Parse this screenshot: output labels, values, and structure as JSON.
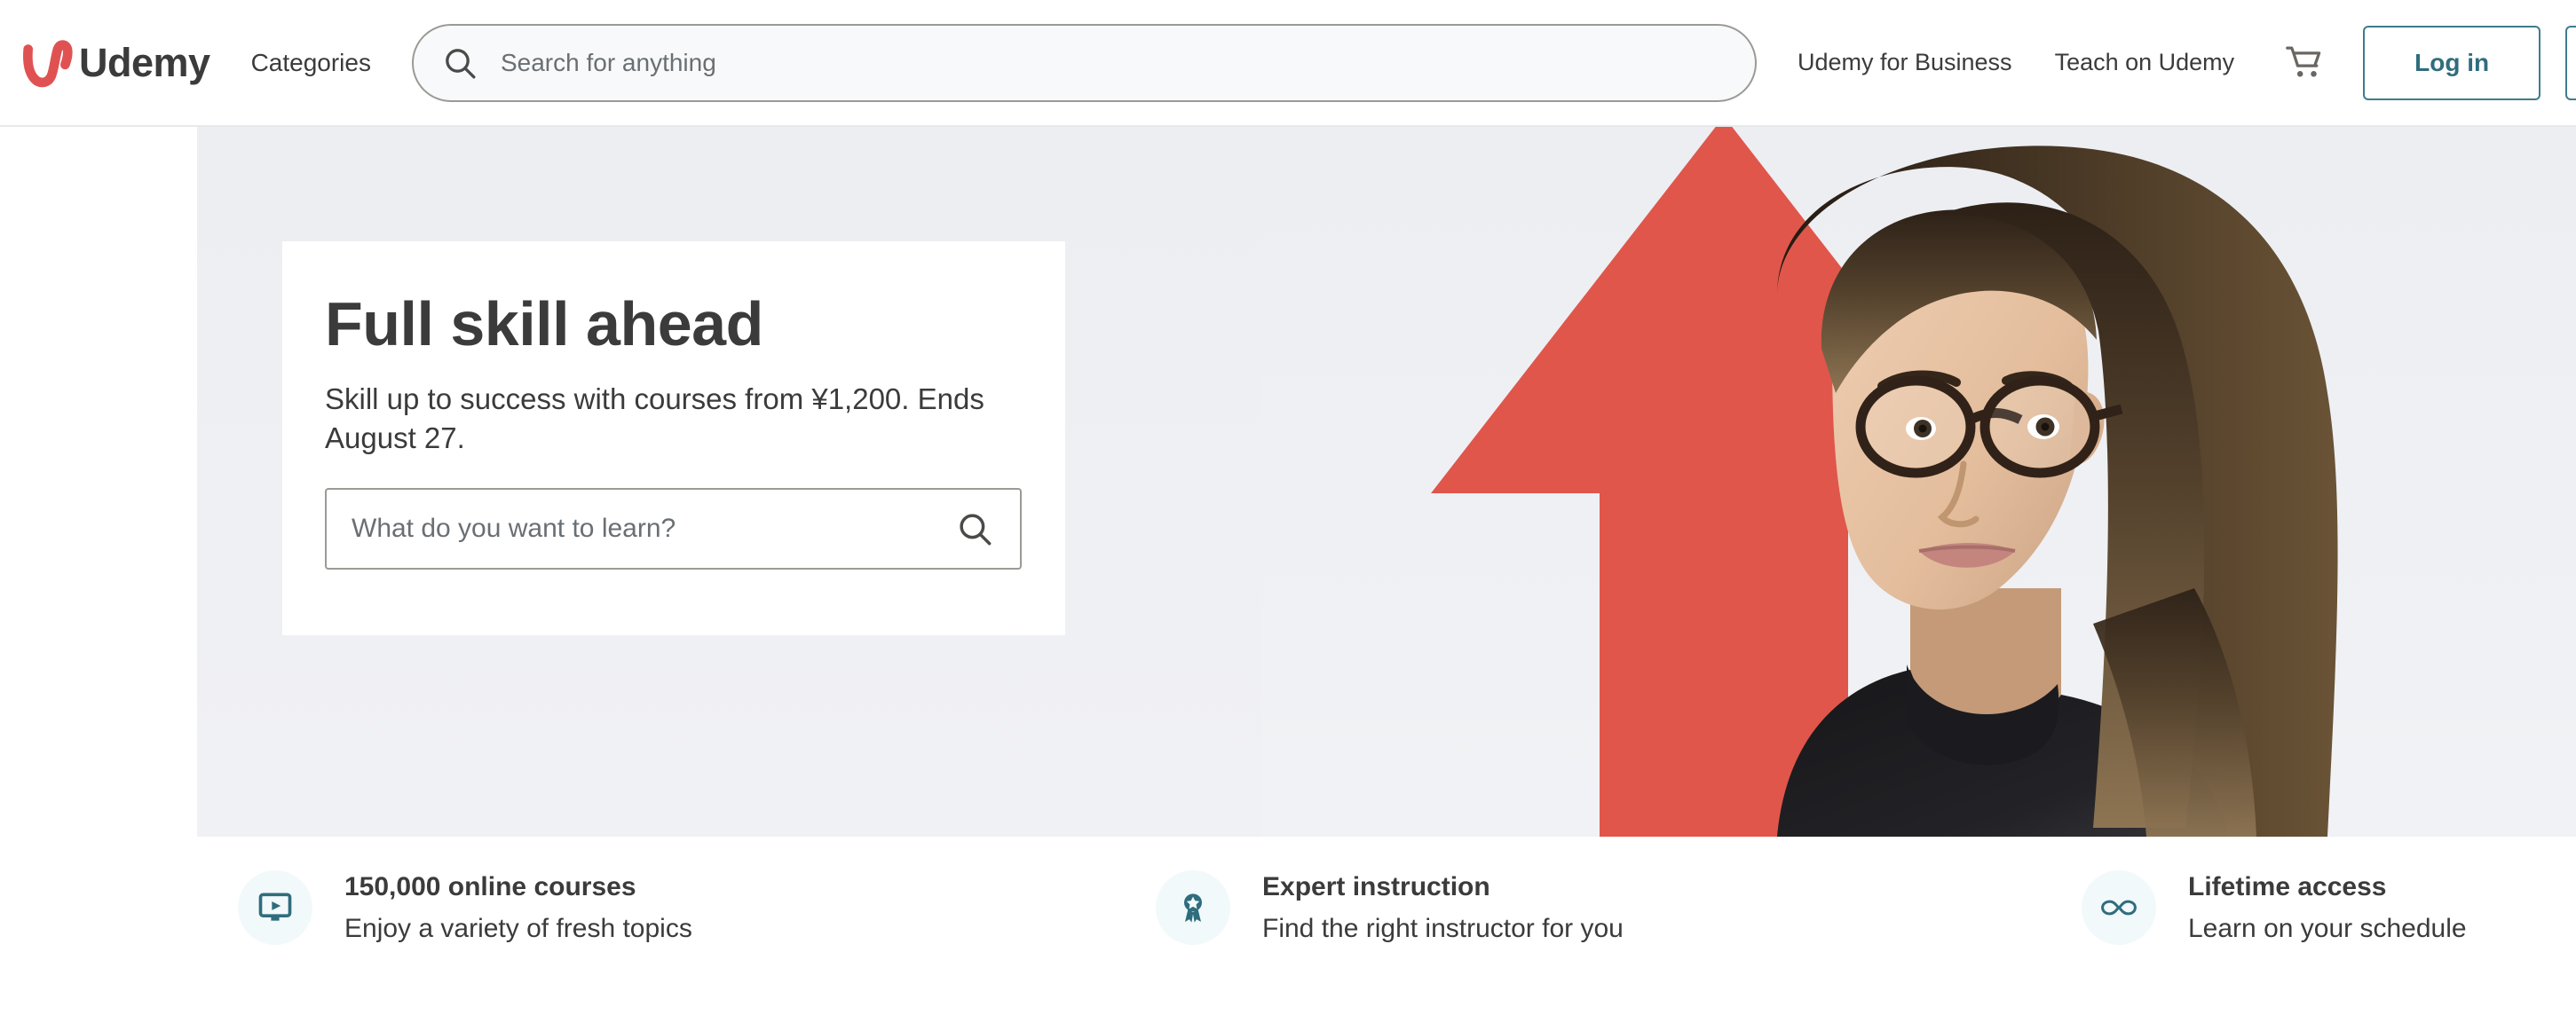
{
  "brand": {
    "name": "Udemy",
    "logo_color": "#e05252",
    "wordmark_color": "#3b3b3b",
    "accent_color": "#2f6d7d"
  },
  "header": {
    "categories_label": "Categories",
    "search": {
      "placeholder": "Search for anything",
      "value": "",
      "icon": "search-icon"
    },
    "links": [
      {
        "label": "Udemy for Business"
      },
      {
        "label": "Teach on Udemy"
      }
    ],
    "cart_icon": "shopping-cart-icon",
    "login_label": "Log in",
    "signup_label": ""
  },
  "hero": {
    "title": "Full skill ahead",
    "subtitle": "Skill up to success with courses from ¥1,200. Ends August 27.",
    "search": {
      "placeholder": "What do you want to learn?",
      "value": "",
      "icon": "search-icon"
    },
    "background_color": "#eff0f4",
    "arrow_color": "#e0564b",
    "image_alt": "Woman with glasses in front of a large red upward arrow"
  },
  "features": [
    {
      "icon": "monitor-play-icon",
      "title": "150,000 online courses",
      "description": "Enjoy a variety of fresh topics"
    },
    {
      "icon": "award-ribbon-icon",
      "title": "Expert instruction",
      "description": "Find the right instructor for you"
    },
    {
      "icon": "infinity-icon",
      "title": "Lifetime access",
      "description": "Learn on your schedule"
    }
  ]
}
